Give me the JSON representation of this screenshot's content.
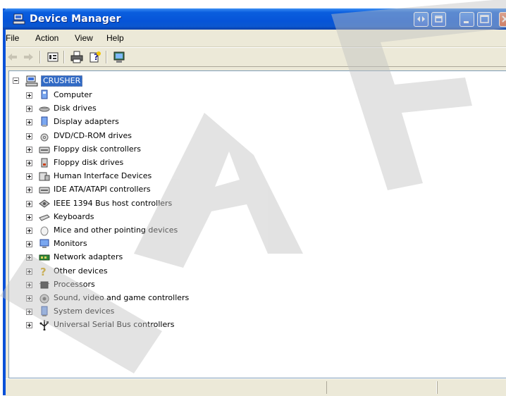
{
  "window": {
    "title": "Device Manager"
  },
  "menu": {
    "items": [
      "File",
      "Action",
      "View",
      "Help"
    ]
  },
  "toolbar": {
    "buttons": [
      {
        "icon": "back-arrow-icon"
      },
      {
        "icon": "forward-arrow-icon"
      },
      {
        "icon": "properties-icon"
      },
      {
        "icon": "print-icon"
      },
      {
        "icon": "help-icon"
      },
      {
        "icon": "scan-hardware-icon"
      }
    ]
  },
  "tree": {
    "root": "CRUSHER",
    "items": [
      {
        "label": "Computer",
        "icon": "computer-icon"
      },
      {
        "label": "Disk drives",
        "icon": "disk-drive-icon"
      },
      {
        "label": "Display adapters",
        "icon": "display-adapter-icon"
      },
      {
        "label": "DVD/CD-ROM drives",
        "icon": "cdrom-icon"
      },
      {
        "label": "Floppy disk controllers",
        "icon": "controller-icon"
      },
      {
        "label": "Floppy disk drives",
        "icon": "floppy-drive-icon"
      },
      {
        "label": "Human Interface Devices",
        "icon": "hid-icon"
      },
      {
        "label": "IDE ATA/ATAPI controllers",
        "icon": "ide-controller-icon"
      },
      {
        "label": "IEEE 1394 Bus host controllers",
        "icon": "ieee1394-icon"
      },
      {
        "label": "Keyboards",
        "icon": "keyboard-icon"
      },
      {
        "label": "Mice and other pointing devices",
        "icon": "mouse-icon"
      },
      {
        "label": "Monitors",
        "icon": "monitor-icon"
      },
      {
        "label": "Network adapters",
        "icon": "network-adapter-icon"
      },
      {
        "label": "Other devices",
        "icon": "unknown-device-icon"
      },
      {
        "label": "Processors",
        "icon": "processor-icon"
      },
      {
        "label": "Sound, video and game controllers",
        "icon": "sound-icon"
      },
      {
        "label": "System devices",
        "icon": "system-device-icon"
      },
      {
        "label": "Universal Serial Bus controllers",
        "icon": "usb-icon"
      }
    ]
  },
  "colors": {
    "titlebar": "#0a5ede",
    "selection": "#316ac5",
    "chrome": "#ece9d8"
  }
}
